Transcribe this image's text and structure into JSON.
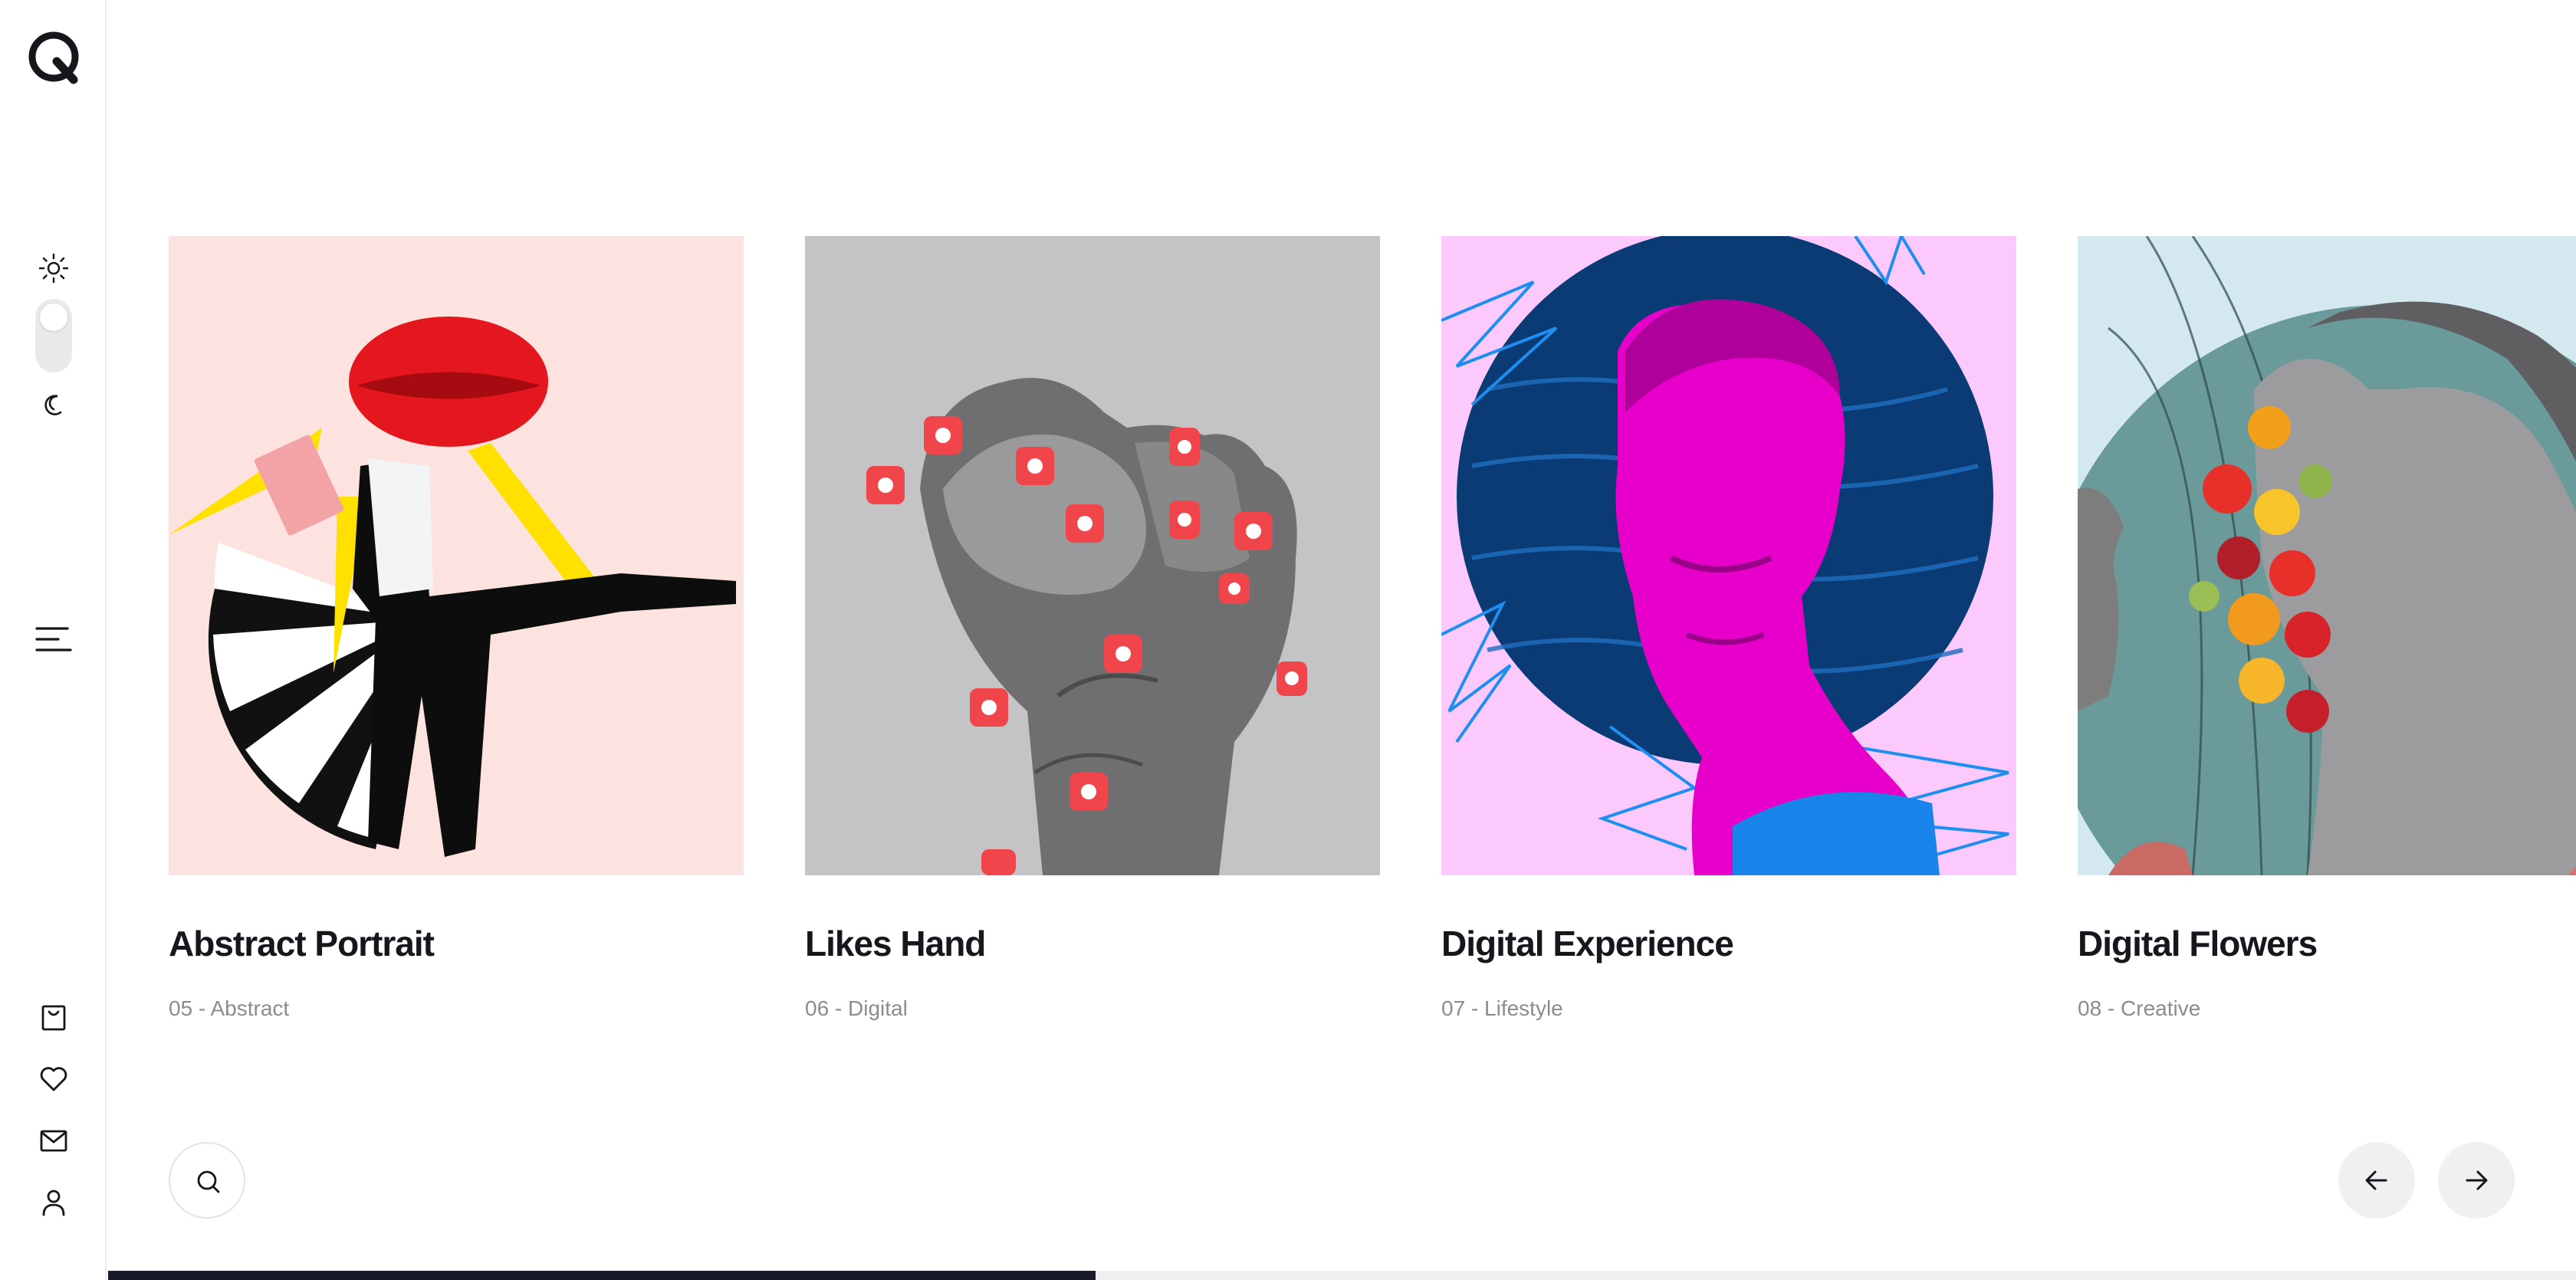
{
  "brand": {
    "logo_icon": "q-logo-icon"
  },
  "sidebar": {
    "theme": {
      "light_icon": "sun-icon",
      "dark_icon": "moon-icon",
      "mode": "light"
    },
    "menu_icon": "menu-icon",
    "bottom_icons": [
      "bag-icon",
      "heart-icon",
      "mail-icon",
      "user-icon"
    ]
  },
  "gallery": {
    "items": [
      {
        "title": "Abstract Portrait",
        "meta": "05 - Abstract",
        "background": "#fde3e0",
        "art": "abstract-portrait-image"
      },
      {
        "title": "Likes Hand",
        "meta": "06 - Digital",
        "background": "#c4c4c6",
        "art": "likes-hand-image"
      },
      {
        "title": "Digital Experience",
        "meta": "07 - Lifestyle",
        "background": "#fbc9fb",
        "art": "digital-experience-image"
      },
      {
        "title": "Digital Flowers",
        "meta": "08 - Creative",
        "background": "#d3e8ef",
        "art": "digital-flowers-image"
      }
    ]
  },
  "controls": {
    "search_icon": "search-icon",
    "prev_icon": "arrow-left-icon",
    "next_icon": "arrow-right-icon"
  },
  "progress": {
    "value": 0.4
  },
  "colors": {
    "text": "#15171c",
    "muted": "#8a8c92",
    "progress": "#181a2a",
    "button_bg": "#f0f0f1"
  }
}
